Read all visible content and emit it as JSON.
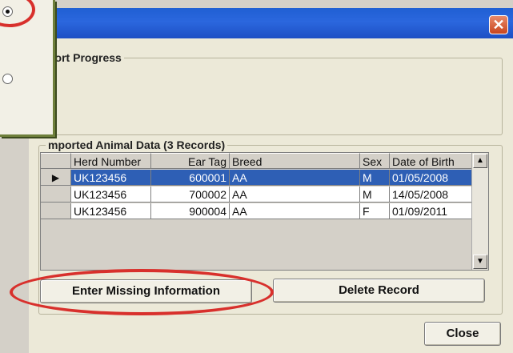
{
  "dialog": {
    "close_glyph": "✕",
    "import_progress_label": "port Progress",
    "imported_data_label": "mported Animal Data (3 Records)"
  },
  "grid": {
    "columns": [
      "Herd Number",
      "Ear Tag",
      "Breed",
      "Sex",
      "Date of Birth"
    ],
    "rows": [
      [
        "UK123456",
        "600001",
        "AA",
        "M",
        "01/05/2008"
      ],
      [
        "UK123456",
        "700002",
        "AA",
        "M",
        "14/05/2008"
      ],
      [
        "UK123456",
        "900004",
        "AA",
        "F",
        "01/09/2011"
      ]
    ],
    "current_row_marker": "▶",
    "scroll_up": "▲",
    "scroll_down": "▼"
  },
  "buttons": {
    "enter_missing": "Enter Missing Information",
    "delete_record": "Delete Record",
    "close": "Close"
  },
  "colors": {
    "selection": "#2e5fb5",
    "annotation": "#d8302c",
    "titlebar": "#2b67de"
  }
}
